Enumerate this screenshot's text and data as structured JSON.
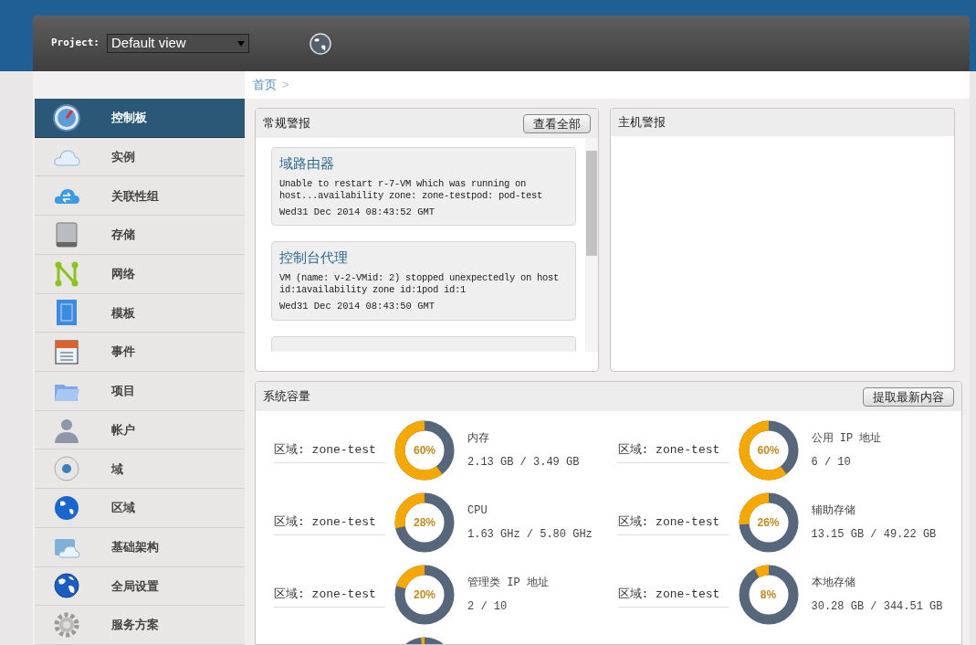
{
  "header": {
    "project_label": "Project:",
    "project_select": "Default view"
  },
  "sidebar": {
    "items": [
      {
        "label": "控制板",
        "selected": true
      },
      {
        "label": "实例",
        "selected": false
      },
      {
        "label": "关联性组",
        "selected": false
      },
      {
        "label": "存储",
        "selected": false
      },
      {
        "label": "网络",
        "selected": false
      },
      {
        "label": "模板",
        "selected": false
      },
      {
        "label": "事件",
        "selected": false
      },
      {
        "label": "项目",
        "selected": false
      },
      {
        "label": "帐户",
        "selected": false
      },
      {
        "label": "域",
        "selected": false
      },
      {
        "label": "区域",
        "selected": false
      },
      {
        "label": "基础架构",
        "selected": false
      },
      {
        "label": "全局设置",
        "selected": false
      },
      {
        "label": "服务方案",
        "selected": false
      }
    ]
  },
  "breadcrumb": {
    "items": [
      "首页"
    ],
    "separator": ">"
  },
  "general_alerts": {
    "title": "常规警报",
    "button": "查看全部",
    "alerts": [
      {
        "title": "域路由器",
        "message": "Unable to restart r-7-VM which was running on host...availability zone: zone-testpod: pod-test",
        "time": "Wed31 Dec 2014 08:43:52 GMT"
      },
      {
        "title": "控制台代理",
        "message": "VM (name: v-2-VMid: 2) stopped unexpectedly on host id:1availability zone id:1pod id:1",
        "time": "Wed31 Dec 2014 08:43:50 GMT"
      }
    ]
  },
  "host_alerts": {
    "title": "主机警报"
  },
  "system_capacity": {
    "title": "系统容量",
    "button": "提取最新内容",
    "items": [
      {
        "zone": "区域: zone-test",
        "percent": "60%",
        "level": 0.6,
        "name": "内存",
        "usage": "2.13 GB / 3.49 GB"
      },
      {
        "zone": "区域: zone-test",
        "percent": "60%",
        "level": 0.6,
        "name": "公用 IP 地址",
        "usage": "6 / 10"
      },
      {
        "zone": "区域: zone-test",
        "percent": "28%",
        "level": 0.28,
        "name": "CPU",
        "usage": "1.63 GHz / 5.80 GHz"
      },
      {
        "zone": "区域: zone-test",
        "percent": "26%",
        "level": 0.26,
        "name": "辅助存储",
        "usage": "13.15 GB / 49.22 GB"
      },
      {
        "zone": "区域: zone-test",
        "percent": "20%",
        "level": 0.2,
        "name": "管理类 IP 地址",
        "usage": "2 / 10"
      },
      {
        "zone": "区域: zone-test",
        "percent": "8%",
        "level": 0.08,
        "name": "本地存储",
        "usage": "30.28 GB / 344.51 GB"
      },
      {
        "level": 0.02
      }
    ]
  }
}
